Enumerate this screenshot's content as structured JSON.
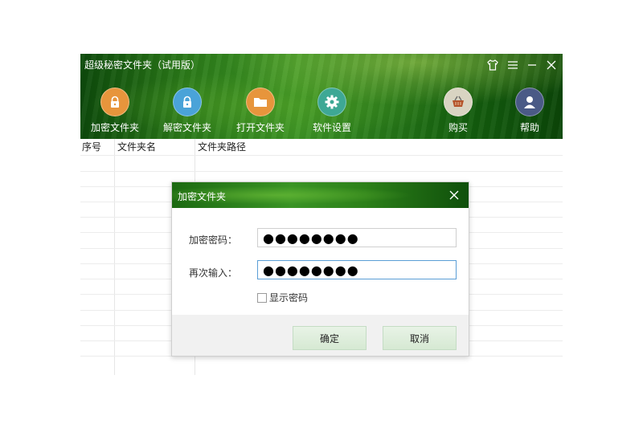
{
  "app": {
    "title": "超级秘密文件夹（试用版）"
  },
  "window_controls": {
    "icons": [
      "skin-icon",
      "menu-icon",
      "minimize-icon",
      "close-icon"
    ]
  },
  "toolbar": {
    "encrypt": {
      "label": "加密文件夹",
      "icon": "lock-icon",
      "color": "#e7953c"
    },
    "decrypt": {
      "label": "解密文件夹",
      "icon": "unlock-icon",
      "color": "#4aa3d8"
    },
    "open": {
      "label": "打开文件夹",
      "icon": "folder-icon",
      "color": "#e7953c"
    },
    "settings": {
      "label": "软件设置",
      "icon": "gear-icon",
      "color": "#3ea895"
    },
    "buy": {
      "label": "购买",
      "icon": "basket-icon",
      "color": "#d9d4c2"
    },
    "help": {
      "label": "帮助",
      "icon": "user-icon",
      "color": "#4a5a86"
    }
  },
  "table": {
    "columns": [
      "序号",
      "文件夹名",
      "文件夹路径"
    ]
  },
  "dialog": {
    "title": "加密文件夹",
    "password_label": "加密密码：",
    "password_value": "●●●●●●●●",
    "confirm_label": "再次输入：",
    "confirm_value": "●●●●●●●●",
    "show_password_label": "显示密码",
    "show_password_checked": false,
    "ok_label": "确定",
    "cancel_label": "取消"
  }
}
